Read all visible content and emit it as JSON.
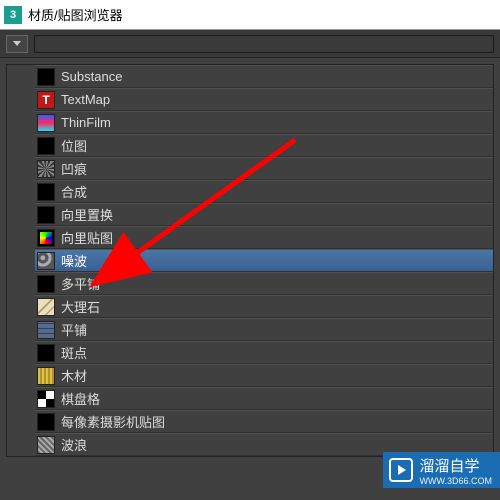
{
  "window": {
    "app_icon_text": "3",
    "title": "材质/贴图浏览器"
  },
  "toolbar": {
    "search_placeholder": ""
  },
  "items": [
    {
      "label": "Substance",
      "icon": "icon-substance",
      "selected": false
    },
    {
      "label": "TextMap",
      "icon": "icon-textmap",
      "icon_text": "T",
      "selected": false
    },
    {
      "label": "ThinFilm",
      "icon": "icon-thinfilm",
      "selected": false
    },
    {
      "label": "位图",
      "icon": "icon-bitmap",
      "selected": false
    },
    {
      "label": "凹痕",
      "icon": "icon-dent",
      "selected": false
    },
    {
      "label": "合成",
      "icon": "icon-composite",
      "selected": false
    },
    {
      "label": "向里置换",
      "icon": "icon-vdisp",
      "selected": false
    },
    {
      "label": "向里贴图",
      "icon": "icon-vmap",
      "selected": false
    },
    {
      "label": "噪波",
      "icon": "icon-noise",
      "selected": true
    },
    {
      "label": "多平铺",
      "icon": "icon-multitile",
      "selected": false
    },
    {
      "label": "大理石",
      "icon": "icon-marble",
      "selected": false
    },
    {
      "label": "平铺",
      "icon": "icon-tiles",
      "selected": false
    },
    {
      "label": "斑点",
      "icon": "icon-speckle",
      "selected": false
    },
    {
      "label": "木材",
      "icon": "icon-wood",
      "selected": false
    },
    {
      "label": "棋盘格",
      "icon": "icon-checker",
      "selected": false
    },
    {
      "label": "每像素摄影机贴图",
      "icon": "icon-percam",
      "selected": false
    },
    {
      "label": "波浪",
      "icon": "icon-waves",
      "selected": false
    }
  ],
  "watermark": {
    "text": "溜溜自学",
    "sub": "WWW.3D66.COM"
  },
  "annotation": {
    "arrow_color": "#ff0000"
  }
}
